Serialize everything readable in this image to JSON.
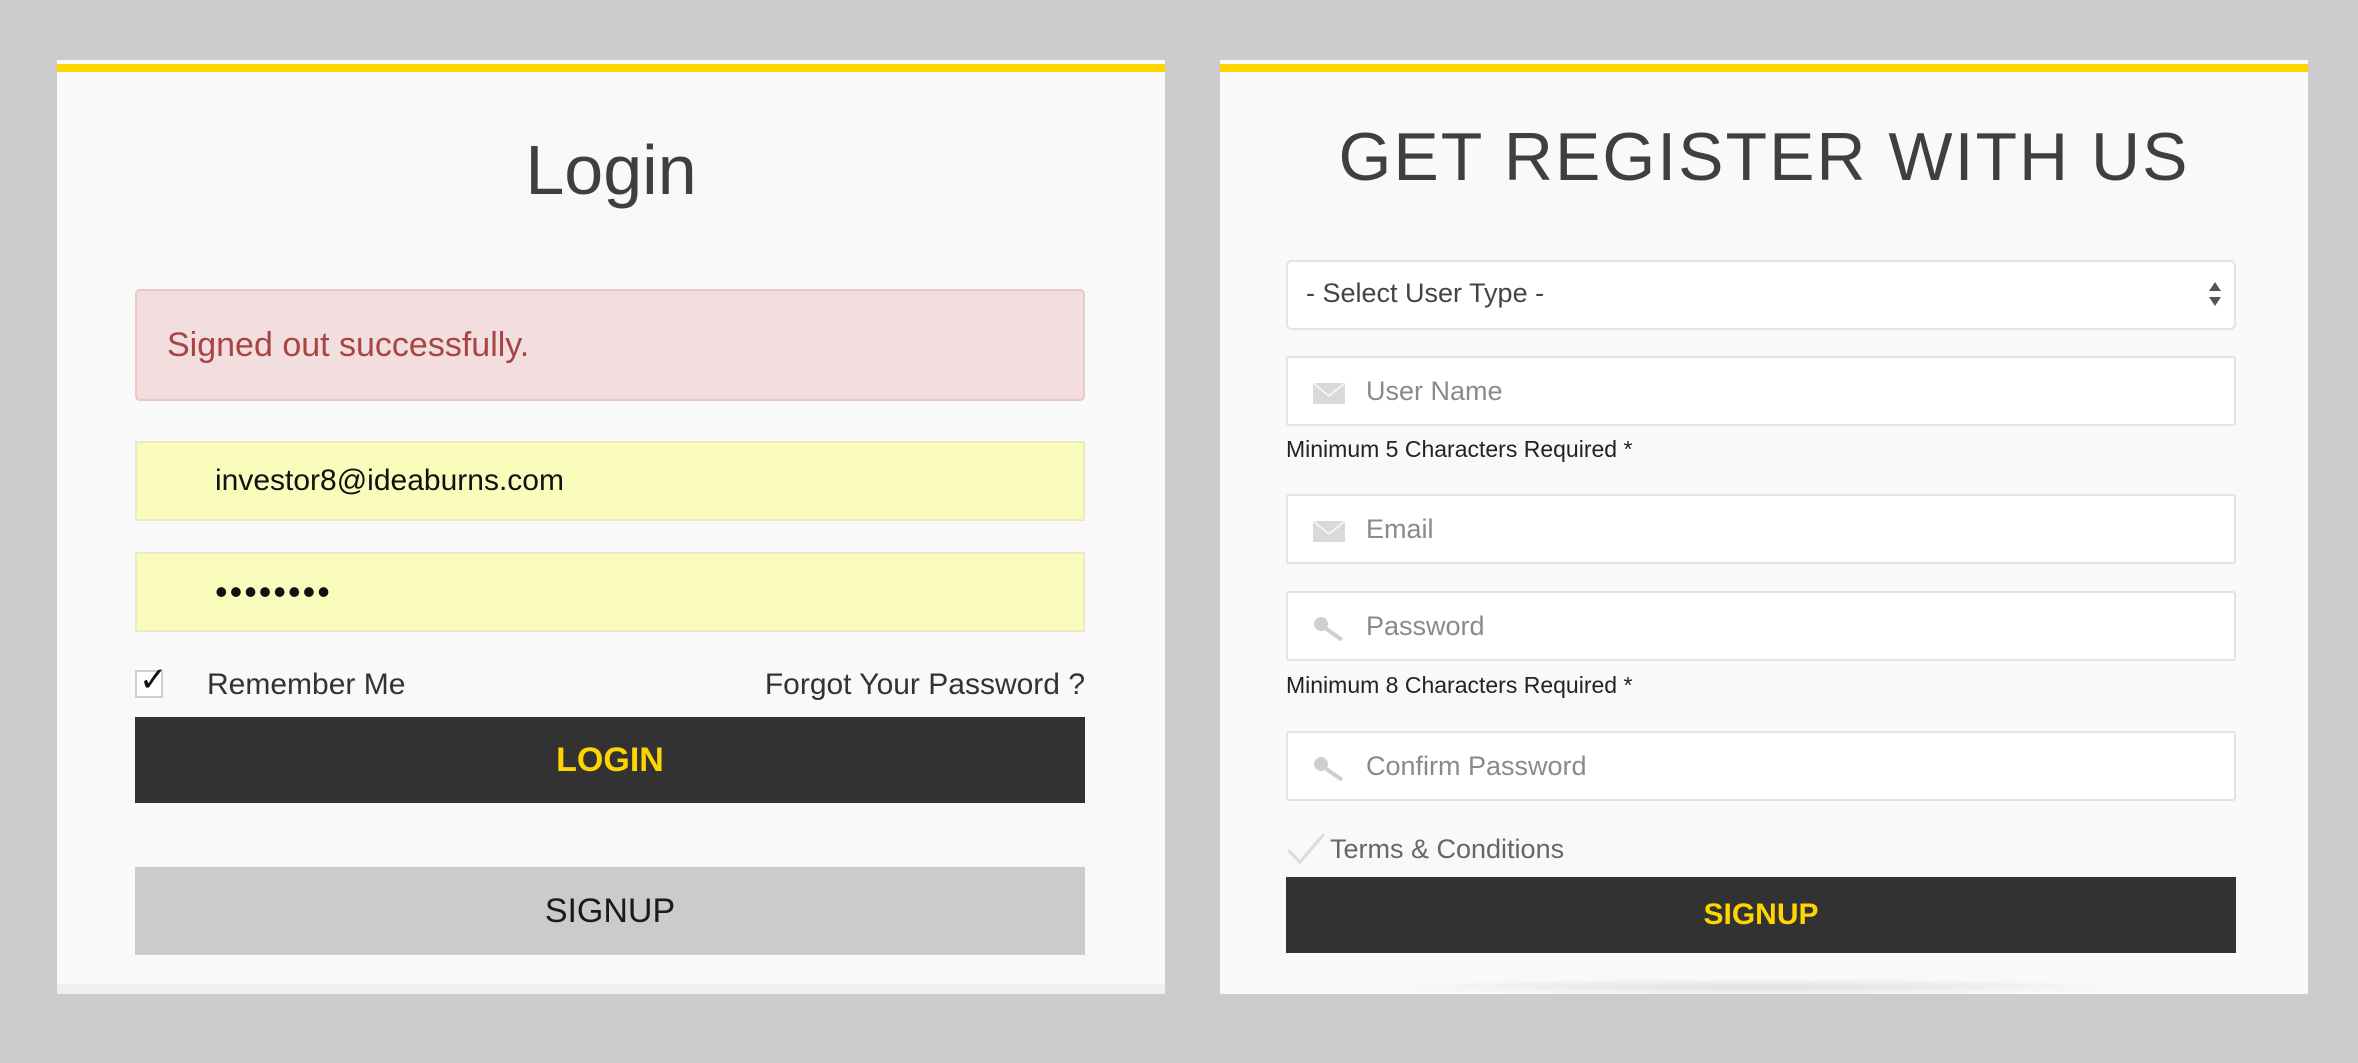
{
  "colors": {
    "accent": "#ffd400",
    "dark_button": "#323232",
    "alert_bg": "#f2dede",
    "alert_text": "#a94442",
    "autofill_bg": "#fafcbc"
  },
  "login": {
    "title": "Login",
    "alert_message": "Signed out successfully.",
    "email_value": "investor8@ideaburns.com",
    "password_value": "••••••••",
    "remember_label": "Remember Me",
    "remember_checked": true,
    "forgot_label": "Forgot Your Password ?",
    "login_button": "LOGIN",
    "signup_button": "SIGNUP"
  },
  "register": {
    "title": "GET REGISTER WITH US",
    "user_type_select": "- Select User Type -",
    "username_placeholder": "User Name",
    "username_hint": "Minimum 5 Characters Required *",
    "email_placeholder": "Email",
    "password_placeholder": "Password",
    "password_hint": "Minimum 8 Characters Required *",
    "confirm_placeholder": "Confirm Password",
    "terms_label": "Terms & Conditions",
    "signup_button": "SIGNUP",
    "icons": {
      "username": "envelope-icon",
      "email": "envelope-icon",
      "password": "key-icon",
      "confirm": "key-icon"
    }
  }
}
